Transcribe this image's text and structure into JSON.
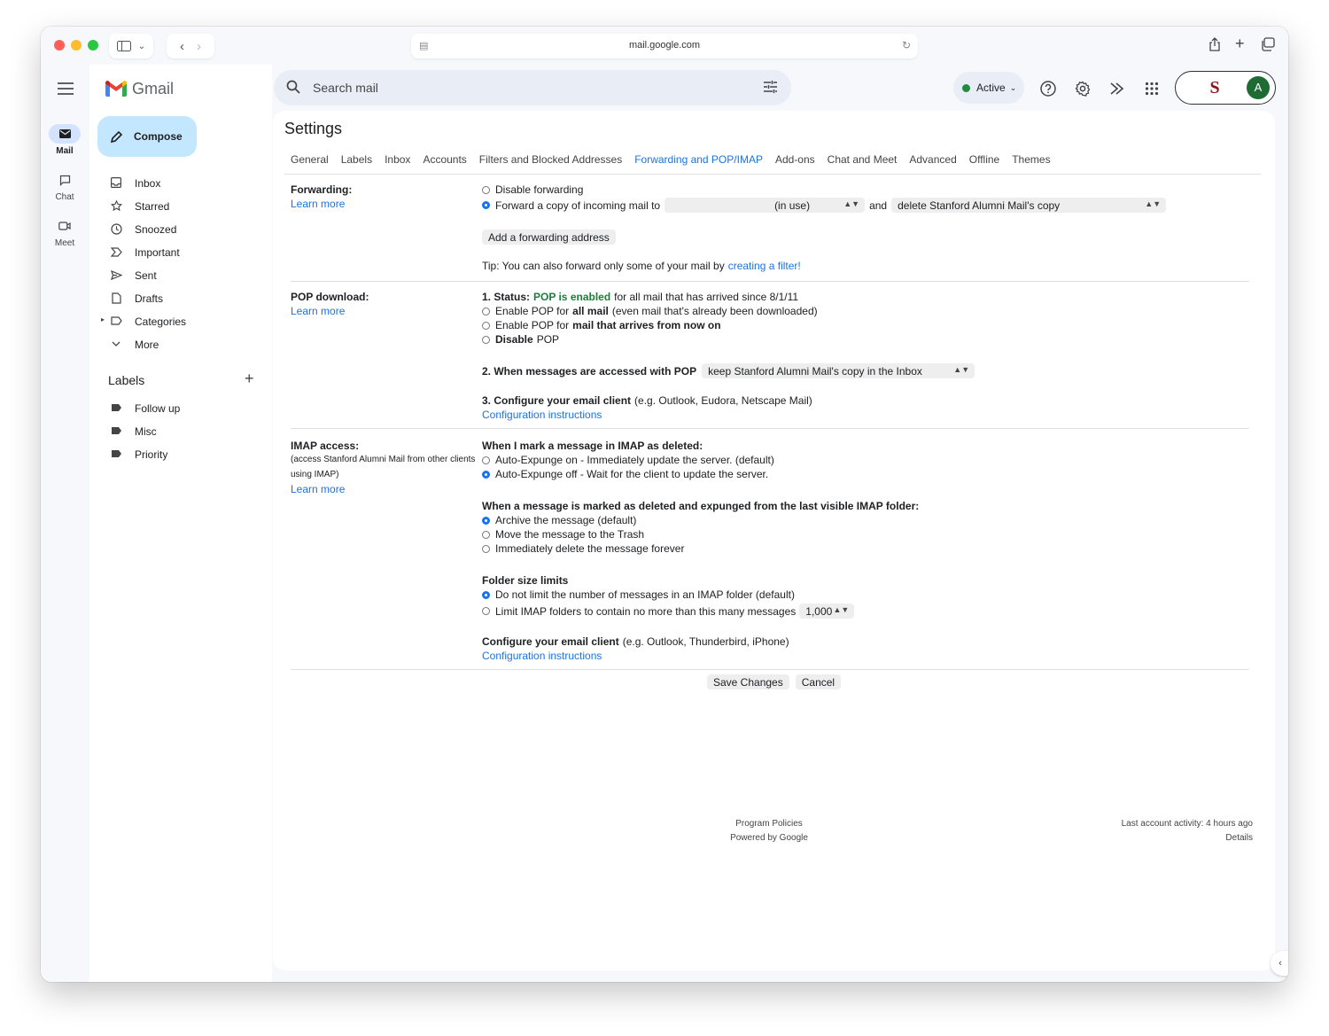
{
  "browser": {
    "url": "mail.google.com"
  },
  "rail": {
    "items": [
      {
        "label": "Mail"
      },
      {
        "label": "Chat"
      },
      {
        "label": "Meet"
      }
    ]
  },
  "app": {
    "name": "Gmail",
    "compose_label": "Compose"
  },
  "nav": {
    "items": [
      {
        "label": "Inbox",
        "icon": "inbox-icon"
      },
      {
        "label": "Starred",
        "icon": "star-icon"
      },
      {
        "label": "Snoozed",
        "icon": "clock-icon"
      },
      {
        "label": "Important",
        "icon": "important-icon"
      },
      {
        "label": "Sent",
        "icon": "send-icon"
      },
      {
        "label": "Drafts",
        "icon": "draft-icon"
      },
      {
        "label": "Categories",
        "icon": "label-outline-icon"
      },
      {
        "label": "More",
        "icon": "chevron-down-icon"
      }
    ]
  },
  "labels": {
    "heading": "Labels",
    "items": [
      {
        "label": "Follow up"
      },
      {
        "label": "Misc"
      },
      {
        "label": "Priority"
      }
    ]
  },
  "search": {
    "placeholder": "Search mail"
  },
  "status": {
    "label": "Active",
    "color": "#1e8e3e"
  },
  "account": {
    "initial": "A",
    "org_mark": "S"
  },
  "settings": {
    "title": "Settings",
    "tabs": [
      {
        "label": "General"
      },
      {
        "label": "Labels"
      },
      {
        "label": "Inbox"
      },
      {
        "label": "Accounts"
      },
      {
        "label": "Filters and Blocked Addresses"
      },
      {
        "label": "Forwarding and POP/IMAP",
        "active": true
      },
      {
        "label": "Add-ons"
      },
      {
        "label": "Chat and Meet"
      },
      {
        "label": "Advanced"
      },
      {
        "label": "Offline"
      },
      {
        "label": "Themes"
      }
    ],
    "learn_more": "Learn more",
    "forwarding": {
      "title": "Forwarding:",
      "disable": "Disable forwarding",
      "forward_copy": "Forward a copy of incoming mail to",
      "address_select": "(in use)",
      "and": "and",
      "action_select": "delete Stanford Alumni Mail's copy",
      "add_button": "Add a forwarding address",
      "tip_text": "Tip: You can also forward only some of your mail by",
      "tip_link": "creating a filter!"
    },
    "pop": {
      "title": "POP download:",
      "status_prefix": "1. Status:",
      "status_value": "POP is enabled",
      "status_suffix": "for all mail that has arrived since 8/1/11",
      "opt1_a": "Enable POP for",
      "opt1_b": "all mail",
      "opt1_c": "(even mail that's already been downloaded)",
      "opt2_a": "Enable POP for",
      "opt2_b": "mail that arrives from now on",
      "opt3_a": "Disable",
      "opt3_b": "POP",
      "step2": "2. When messages are accessed with POP",
      "step2_select": "keep Stanford Alumni Mail's copy in the Inbox",
      "step3": "3. Configure your email client",
      "step3_hint": "(e.g. Outlook, Eudora, Netscape Mail)",
      "config_link": "Configuration instructions"
    },
    "imap": {
      "title": "IMAP access:",
      "subtitle": "(access Stanford Alumni Mail from other clients using IMAP)",
      "deleted_heading": "When I mark a message in IMAP as deleted:",
      "expunge_on": "Auto-Expunge on - Immediately update the server. (default)",
      "expunge_off": "Auto-Expunge off - Wait for the client to update the server.",
      "expunged_heading": "When a message is marked as deleted and expunged from the last visible IMAP folder:",
      "archive": "Archive the message (default)",
      "trash": "Move the message to the Trash",
      "delete_forever": "Immediately delete the message forever",
      "folder_heading": "Folder size limits",
      "no_limit": "Do not limit the number of messages in an IMAP folder (default)",
      "limit": "Limit IMAP folders to contain no more than this many messages",
      "limit_value": "1,000",
      "client_heading": "Configure your email client",
      "client_hint": "(e.g. Outlook, Thunderbird, iPhone)",
      "config_link": "Configuration instructions"
    },
    "save_label": "Save Changes",
    "cancel_label": "Cancel"
  },
  "footer": {
    "policies": "Program Policies",
    "powered": "Powered by Google",
    "last_activity": "Last account activity: 4 hours ago",
    "details": "Details"
  }
}
